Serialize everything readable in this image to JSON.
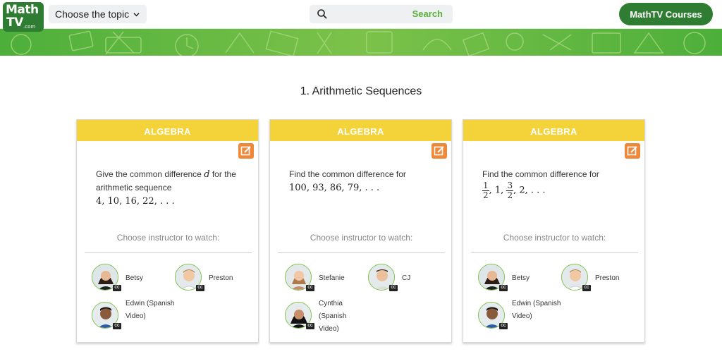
{
  "logo": {
    "line1": "Math",
    "line2": "TV",
    "suffix": ".com"
  },
  "header": {
    "topic_label": "Choose the topic",
    "search_placeholder": "",
    "search_button": "Search",
    "courses_button": "MathTV Courses"
  },
  "page_title": "1. Arithmetic Sequences",
  "colors": {
    "brand_green": "#2e7d32",
    "accent_green": "#5ab03c",
    "card_header": "#f4d33a",
    "edit_orange": "#f0883a"
  },
  "cards": [
    {
      "category": "ALGEBRA",
      "problem_text_before": "Give the common difference ",
      "problem_var": "d",
      "problem_text_after": " for the arithmetic sequence",
      "sequence": "4, 10, 16, 22, . . .",
      "choose_label": "Choose instructor to watch:",
      "instructors": [
        {
          "name": "Betsy",
          "cc": "CC",
          "icon": "instructor-avatar"
        },
        {
          "name": "Preston",
          "cc": "CC",
          "icon": "instructor-avatar"
        },
        {
          "name": "Edwin (Spanish Video)",
          "cc": "CC",
          "icon": "instructor-avatar"
        }
      ]
    },
    {
      "category": "ALGEBRA",
      "problem_text": "Find the common difference for",
      "sequence": "100, 93, 86, 79, . . .",
      "choose_label": "Choose instructor to watch:",
      "instructors": [
        {
          "name": "Stefanie",
          "cc": "CC",
          "icon": "instructor-avatar"
        },
        {
          "name": "CJ",
          "cc": "CC",
          "icon": "instructor-avatar"
        },
        {
          "name": "Cynthia (Spanish Video)",
          "cc": "CC",
          "icon": "instructor-avatar"
        }
      ]
    },
    {
      "category": "ALGEBRA",
      "problem_text": "Find the common difference for",
      "sequence_parts": {
        "f1_num": "1",
        "f1_den": "2",
        "mid": ", 1, ",
        "f2_num": "3",
        "f2_den": "2",
        "tail": ", 2, . . ."
      },
      "choose_label": "Choose instructor to watch:",
      "instructors": [
        {
          "name": "Betsy",
          "cc": "CC",
          "icon": "instructor-avatar"
        },
        {
          "name": "Preston",
          "cc": "CC",
          "icon": "instructor-avatar"
        },
        {
          "name": "Edwin (Spanish Video)",
          "cc": "CC",
          "icon": "instructor-avatar"
        }
      ]
    }
  ]
}
